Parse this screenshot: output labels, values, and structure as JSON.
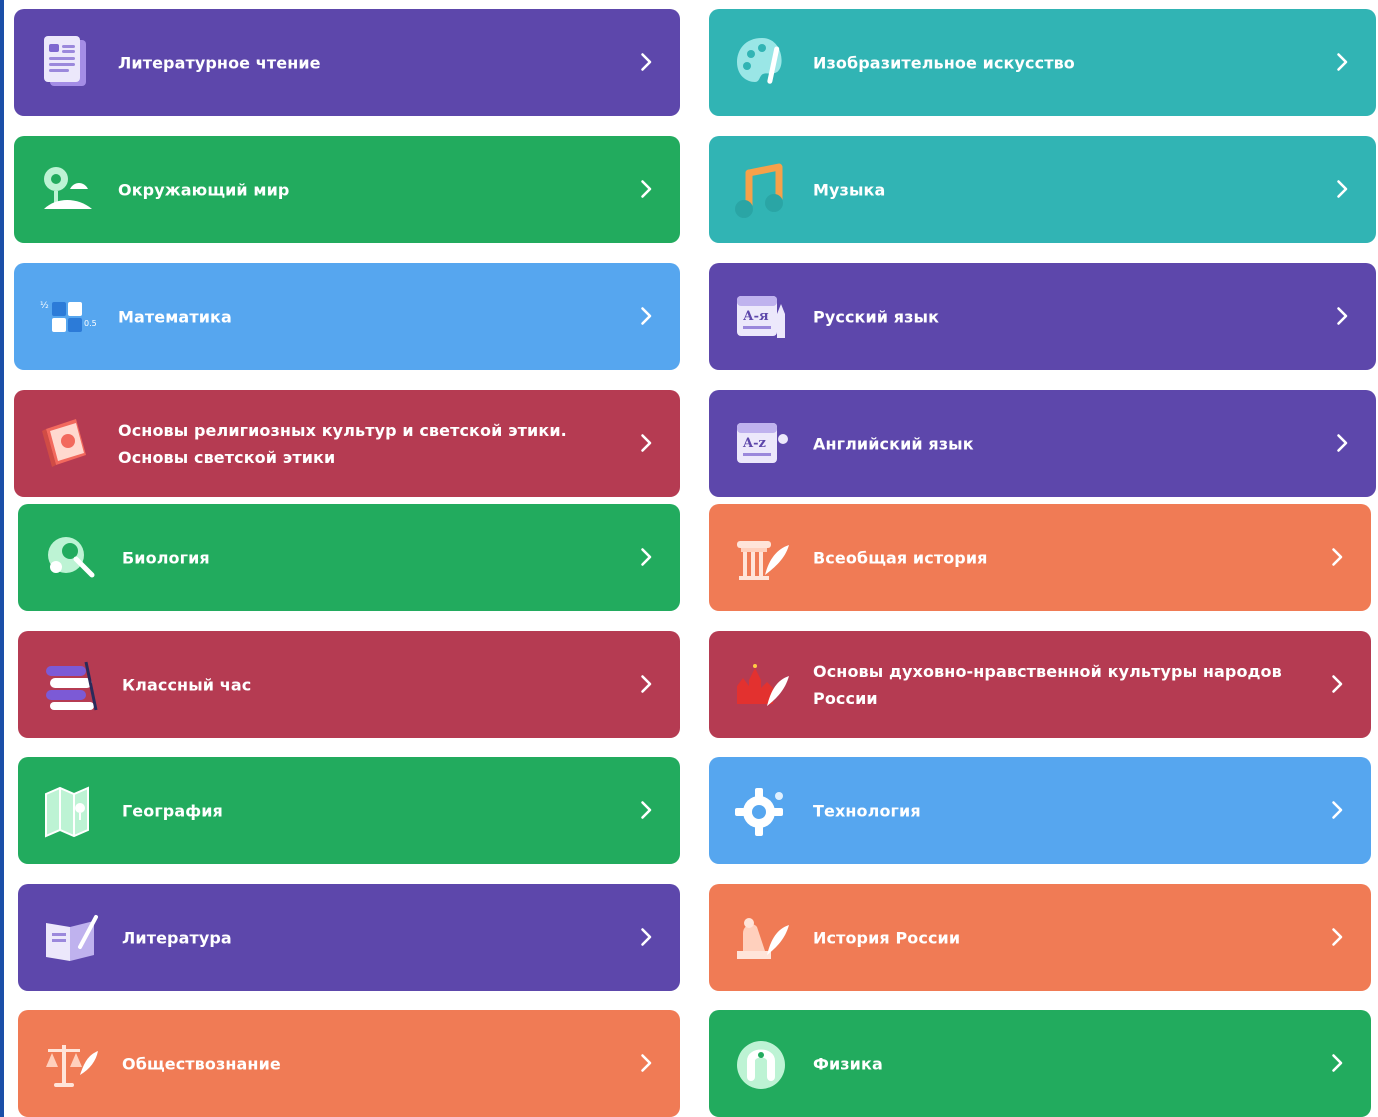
{
  "colors": {
    "purple": "#5d47ab",
    "green": "#22ab5e",
    "teal": "#31b4b4",
    "blue": "#56a6ef",
    "crimson": "#b53b52",
    "orange": "#f07b55"
  },
  "subjects": [
    {
      "label": "Литературное чтение",
      "color": "#5d47ab",
      "icon": "book-pages-icon"
    },
    {
      "label": "Изобразительное искусство",
      "color": "#31b4b4",
      "icon": "palette-icon"
    },
    {
      "label": "Окружающий мир",
      "color": "#22ab5e",
      "icon": "nature-icon"
    },
    {
      "label": "Музыка",
      "color": "#31b4b4",
      "icon": "music-note-icon"
    },
    {
      "label": "Математика",
      "color": "#56a6ef",
      "icon": "math-blocks-icon"
    },
    {
      "label": "Русский язык",
      "color": "#5d47ab",
      "icon": "russian-alphabet-icon"
    },
    {
      "label": "Основы религиозных культур и светской этики. Основы светской этики",
      "color": "#b53b52",
      "icon": "ethics-book-icon"
    },
    {
      "label": "Английский язык",
      "color": "#5d47ab",
      "icon": "english-alphabet-icon"
    },
    {
      "label": "Биология",
      "color": "#22ab5e",
      "icon": "biology-icon"
    },
    {
      "label": "Всеобщая история",
      "color": "#f07b55",
      "icon": "column-quill-icon"
    },
    {
      "label": "Классный час",
      "color": "#b53b52",
      "icon": "books-stack-icon"
    },
    {
      "label": "Основы духовно-нравственной культуры народов России",
      "color": "#b53b52",
      "icon": "kremlin-quill-icon"
    },
    {
      "label": "География",
      "color": "#22ab5e",
      "icon": "map-icon"
    },
    {
      "label": "Технология",
      "color": "#56a6ef",
      "icon": "gear-icon"
    },
    {
      "label": "Литература",
      "color": "#5d47ab",
      "icon": "open-book-icon"
    },
    {
      "label": "История России",
      "color": "#f07b55",
      "icon": "monument-quill-icon"
    },
    {
      "label": "Обществознание",
      "color": "#f07b55",
      "icon": "scales-icon"
    },
    {
      "label": "Физика",
      "color": "#22ab5e",
      "icon": "magnet-icon"
    }
  ]
}
